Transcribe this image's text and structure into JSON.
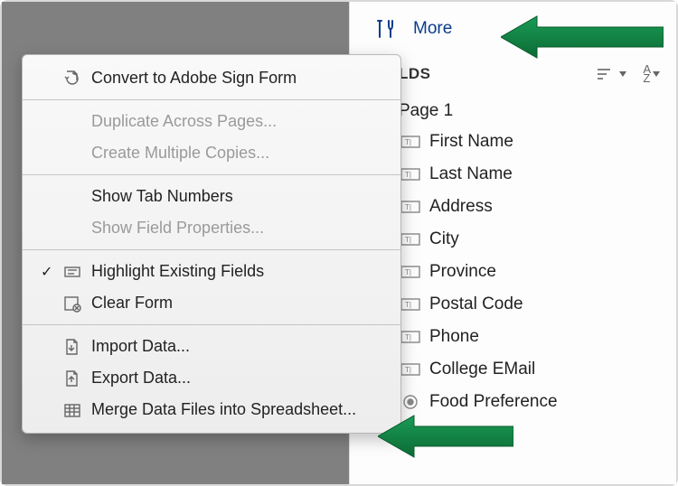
{
  "panel": {
    "more_label": "More",
    "fields_header": "FIELDS",
    "page_label": "Page 1",
    "fields": [
      {
        "label": "First Name",
        "type": "text"
      },
      {
        "label": "Last Name",
        "type": "text"
      },
      {
        "label": "Address",
        "type": "text"
      },
      {
        "label": "City",
        "type": "text"
      },
      {
        "label": "Province",
        "type": "text"
      },
      {
        "label": "Postal Code",
        "type": "text"
      },
      {
        "label": "Phone",
        "type": "text"
      },
      {
        "label": "College EMail",
        "type": "text"
      },
      {
        "label": "Food Preference",
        "type": "radio"
      }
    ]
  },
  "menu": {
    "items": [
      {
        "label": "Convert to Adobe Sign Form",
        "enabled": true,
        "icon": "convert-icon"
      },
      {
        "sep": true
      },
      {
        "label": "Duplicate Across Pages...",
        "enabled": false,
        "indent": true
      },
      {
        "label": "Create Multiple Copies...",
        "enabled": false,
        "indent": true
      },
      {
        "sep": true
      },
      {
        "label": "Show Tab Numbers",
        "enabled": true,
        "indent": true
      },
      {
        "label": "Show Field Properties...",
        "enabled": false,
        "indent": true
      },
      {
        "sep": true
      },
      {
        "label": "Highlight Existing Fields",
        "enabled": true,
        "icon": "highlight-icon",
        "checked": true
      },
      {
        "label": "Clear Form",
        "enabled": true,
        "icon": "clear-form-icon"
      },
      {
        "sep": true
      },
      {
        "label": "Import Data...",
        "enabled": true,
        "icon": "import-icon"
      },
      {
        "label": "Export Data...",
        "enabled": true,
        "icon": "export-icon"
      },
      {
        "label": "Merge Data Files into Spreadsheet...",
        "enabled": true,
        "icon": "merge-icon"
      }
    ]
  },
  "colors": {
    "accent": "#0a3c8a",
    "arrow": "#0c7a3e"
  }
}
